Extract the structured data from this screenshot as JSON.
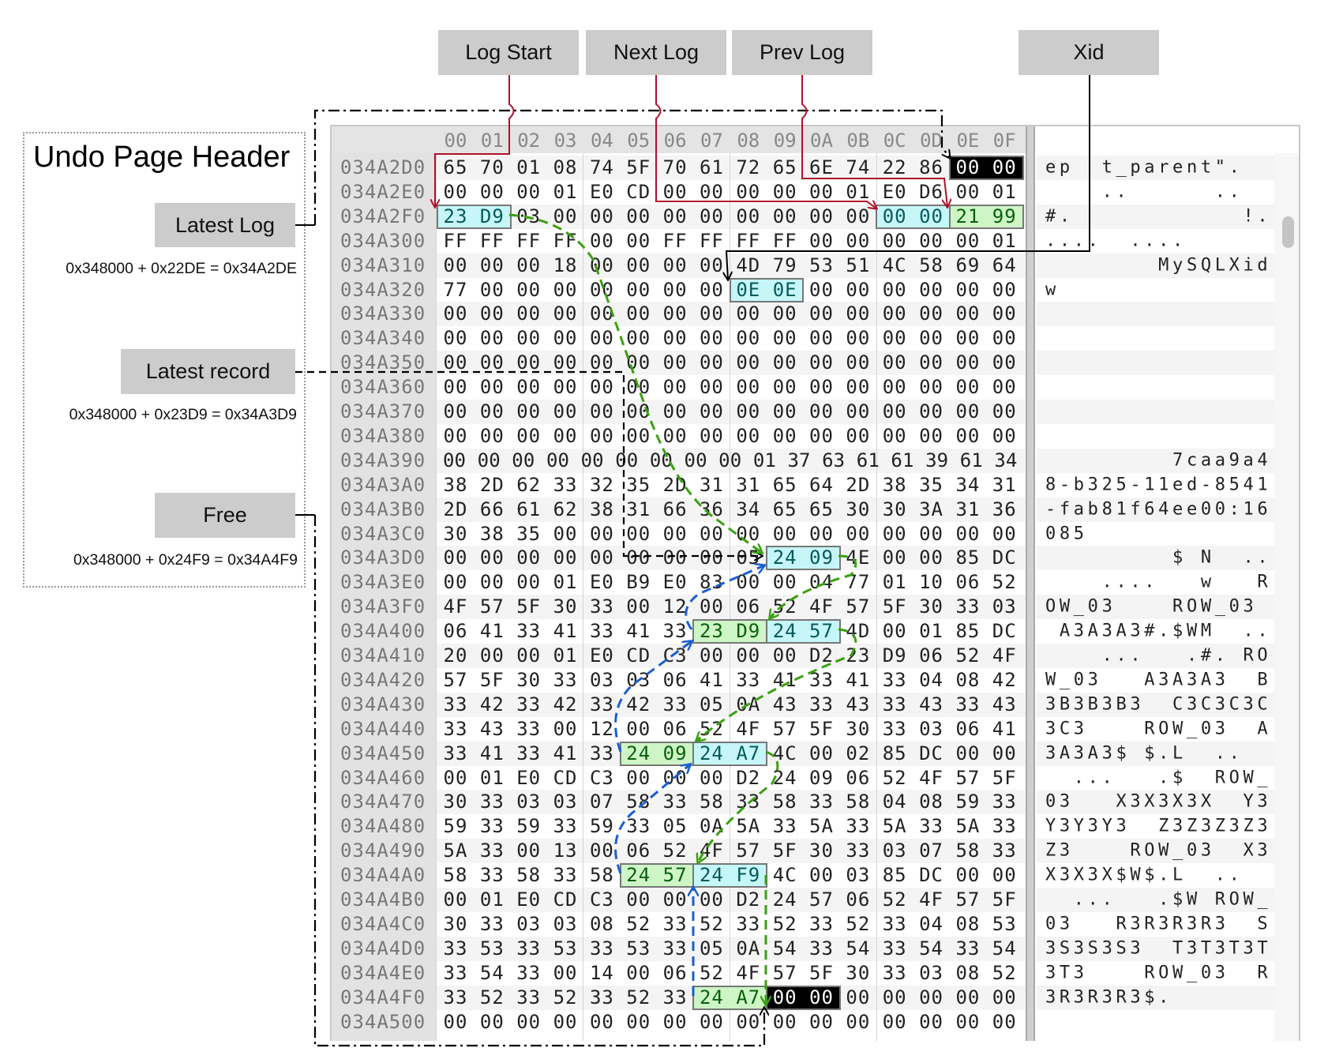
{
  "header_panel": {
    "title": "Undo Page Header",
    "fields": [
      {
        "label": "Latest Log",
        "formula": "0x348000 + 0x22DE = 0x34A2DE"
      },
      {
        "label": "Latest record",
        "formula": "0x348000 + 0x23D9 = 0x34A3D9"
      },
      {
        "label": "Free",
        "formula": "0x348000 + 0x24F9 = 0x34A4F9"
      }
    ]
  },
  "top_labels": [
    "Log Start",
    "Next Log",
    "Prev Log",
    "Xid"
  ],
  "colors": {
    "label_bg": "#cccccc",
    "cyan_highlight": "#c6f6f8",
    "green_highlight": "#cdf5c6",
    "black_highlight": "#000000",
    "log_pointer_lines": "#b0102a",
    "next_chain": "#3aa010",
    "prev_chain": "#1a5fd0"
  },
  "hex_view": {
    "column_headers": [
      "00",
      "01",
      "02",
      "03",
      "04",
      "05",
      "06",
      "07",
      "08",
      "09",
      "0A",
      "0B",
      "0C",
      "0D",
      "0E",
      "0F"
    ],
    "rows": [
      {
        "address": "034A2D0",
        "bytes": "65 70 01 08 74 5F 70 61 72 65 6E 74 22 86 00 00",
        "ascii": "ep  t_parent\".  "
      },
      {
        "address": "034A2E0",
        "bytes": "00 00 00 01 E0 CD 00 00 00 00 00 01 E0 D6 00 01",
        "ascii": "    ..      ..  "
      },
      {
        "address": "034A2F0",
        "bytes": "23 D9 03 00 00 00 00 00 00 00 00 00 00 00 21 99",
        "ascii": "#.            !."
      },
      {
        "address": "034A300",
        "bytes": "FF FF FF FF 00 00 FF FF FF FF 00 00 00 00 00 01",
        "ascii": "....  ....      "
      },
      {
        "address": "034A310",
        "bytes": "00 00 00 18 00 00 00 00 4D 79 53 51 4C 58 69 64",
        "ascii": "        MySQLXid"
      },
      {
        "address": "034A320",
        "bytes": "77 00 00 00 00 00 00 00 0E 0E 00 00 00 00 00 00",
        "ascii": "w               "
      },
      {
        "address": "034A330",
        "bytes": "00 00 00 00 00 00 00 00 00 00 00 00 00 00 00 00",
        "ascii": ""
      },
      {
        "address": "034A340",
        "bytes": "00 00 00 00 00 00 00 00 00 00 00 00 00 00 00 00",
        "ascii": ""
      },
      {
        "address": "034A350",
        "bytes": "00 00 00 00 00 00 00 00 00 00 00 00 00 00 00 00",
        "ascii": ""
      },
      {
        "address": "034A360",
        "bytes": "00 00 00 00 00 00 00 00 00 00 00 00 00 00 00 00",
        "ascii": ""
      },
      {
        "address": "034A370",
        "bytes": "00 00 00 00 00 00 00 00 00 00 00 00 00 00 00 00",
        "ascii": ""
      },
      {
        "address": "034A380",
        "bytes": "00 00 00 00 00 00 00 00 00 00 00 00 00 00 00 00",
        "ascii": ""
      },
      {
        "address": "034A390",
        "bytes": "00 00 00 00 00 00 00 00 00 01 37 63 61 61 39 61 34",
        "ascii": "         7caa9a4"
      },
      {
        "address": "034A3A0",
        "bytes": "38 2D 62 33 32 35 2D 31 31 65 64 2D 38 35 34 31",
        "ascii": "8-b325-11ed-8541"
      },
      {
        "address": "034A3B0",
        "bytes": "2D 66 61 62 38 31 66 36 34 65 65 30 30 3A 31 36",
        "ascii": "-fab81f64ee00:16"
      },
      {
        "address": "034A3C0",
        "bytes": "30 38 35 00 00 00 00 00 00 00 00 00 00 00 00 00",
        "ascii": "085             "
      },
      {
        "address": "034A3D0",
        "bytes": "00 00 00 00 00 00 00 00 05 24 09 4E 00 00 85 DC",
        "ascii": "         $ N  .."
      },
      {
        "address": "034A3E0",
        "bytes": "00 00 00 01 E0 B9 E0 83 00 00 04 77 01 10 06 52",
        "ascii": "    ....   w   R"
      },
      {
        "address": "034A3F0",
        "bytes": "4F 57 5F 30 33 00 12 00 06 52 4F 57 5F 30 33 03",
        "ascii": "OW_03    ROW_03 "
      },
      {
        "address": "034A400",
        "bytes": "06 41 33 41 33 41 33 23 D9 24 57 4D 00 01 85 DC",
        "ascii": " A3A3A3#.$WM  .."
      },
      {
        "address": "034A410",
        "bytes": "20 00 00 01 E0 CD C3 00 00 00 D2 23 D9 06 52 4F",
        "ascii": "    ...   .#. RO"
      },
      {
        "address": "034A420",
        "bytes": "57 5F 30 33 03 03 06 41 33 41 33 41 33 04 08 42",
        "ascii": "W_03   A3A3A3  B"
      },
      {
        "address": "034A430",
        "bytes": "33 42 33 42 33 42 33 05 0A 43 33 43 33 43 33 43",
        "ascii": "3B3B3B3  C3C3C3C"
      },
      {
        "address": "034A440",
        "bytes": "33 43 33 00 12 00 06 52 4F 57 5F 30 33 03 06 41",
        "ascii": "3C3    ROW_03  A"
      },
      {
        "address": "034A450",
        "bytes": "33 41 33 41 33 24 09 24 A7 4C 00 02 85 DC 00 00",
        "ascii": "3A3A3$ $.L  ..  "
      },
      {
        "address": "034A460",
        "bytes": "00 01 E0 CD C3 00 00 00 D2 24 09 06 52 4F 57 5F",
        "ascii": "  ...   .$  ROW_"
      },
      {
        "address": "034A470",
        "bytes": "30 33 03 03 07 58 33 58 33 58 33 58 04 08 59 33",
        "ascii": "03   X3X3X3X  Y3"
      },
      {
        "address": "034A480",
        "bytes": "59 33 59 33 59 33 05 0A 5A 33 5A 33 5A 33 5A 33",
        "ascii": "Y3Y3Y3  Z3Z3Z3Z3"
      },
      {
        "address": "034A490",
        "bytes": "5A 33 00 13 00 06 52 4F 57 5F 30 33 03 07 58 33",
        "ascii": "Z3    ROW_03  X3"
      },
      {
        "address": "034A4A0",
        "bytes": "58 33 58 33 58 24 57 24 F9 4C 00 03 85 DC 00 00",
        "ascii": "X3X3X$W$.L  ..  "
      },
      {
        "address": "034A4B0",
        "bytes": "00 01 E0 CD C3 00 00 00 D2 24 57 06 52 4F 57 5F",
        "ascii": "  ...   .$W ROW_"
      },
      {
        "address": "034A4C0",
        "bytes": "30 33 03 03 08 52 33 52 33 52 33 52 33 04 08 53",
        "ascii": "03   R3R3R3R3  S"
      },
      {
        "address": "034A4D0",
        "bytes": "33 53 33 53 33 53 33 05 0A 54 33 54 33 54 33 54",
        "ascii": "3S3S3S3  T3T3T3T"
      },
      {
        "address": "034A4E0",
        "bytes": "33 54 33 00 14 00 06 52 4F 57 5F 30 33 03 08 52",
        "ascii": "3T3    ROW_03  R"
      },
      {
        "address": "034A4F0",
        "bytes": "33 52 33 52 33 52 33 24 A7 00 00 00 00 00 00 00",
        "ascii": "3R3R3R3$.       "
      },
      {
        "address": "034A500",
        "bytes": "00 00 00 00 00 00 00 00 00 00 00 00 00 00 00 00",
        "ascii": ""
      }
    ],
    "highlights": [
      {
        "address": "034A2D0",
        "col": 14,
        "len": 2,
        "style": "black"
      },
      {
        "address": "034A2F0",
        "col": 0,
        "len": 2,
        "style": "cyan"
      },
      {
        "address": "034A2F0",
        "col": 12,
        "len": 2,
        "style": "cyan"
      },
      {
        "address": "034A2F0",
        "col": 14,
        "len": 2,
        "style": "green"
      },
      {
        "address": "034A320",
        "col": 8,
        "len": 2,
        "style": "cyan"
      },
      {
        "address": "034A3D0",
        "col": 9,
        "len": 2,
        "style": "cyan"
      },
      {
        "address": "034A400",
        "col": 7,
        "len": 2,
        "style": "green"
      },
      {
        "address": "034A400",
        "col": 9,
        "len": 2,
        "style": "cyan"
      },
      {
        "address": "034A450",
        "col": 5,
        "len": 2,
        "style": "green"
      },
      {
        "address": "034A450",
        "col": 7,
        "len": 2,
        "style": "cyan"
      },
      {
        "address": "034A4A0",
        "col": 5,
        "len": 2,
        "style": "green"
      },
      {
        "address": "034A4A0",
        "col": 7,
        "len": 2,
        "style": "cyan"
      },
      {
        "address": "034A4F0",
        "col": 7,
        "len": 2,
        "style": "green"
      },
      {
        "address": "034A4F0",
        "col": 9,
        "len": 2,
        "style": "black"
      }
    ]
  }
}
